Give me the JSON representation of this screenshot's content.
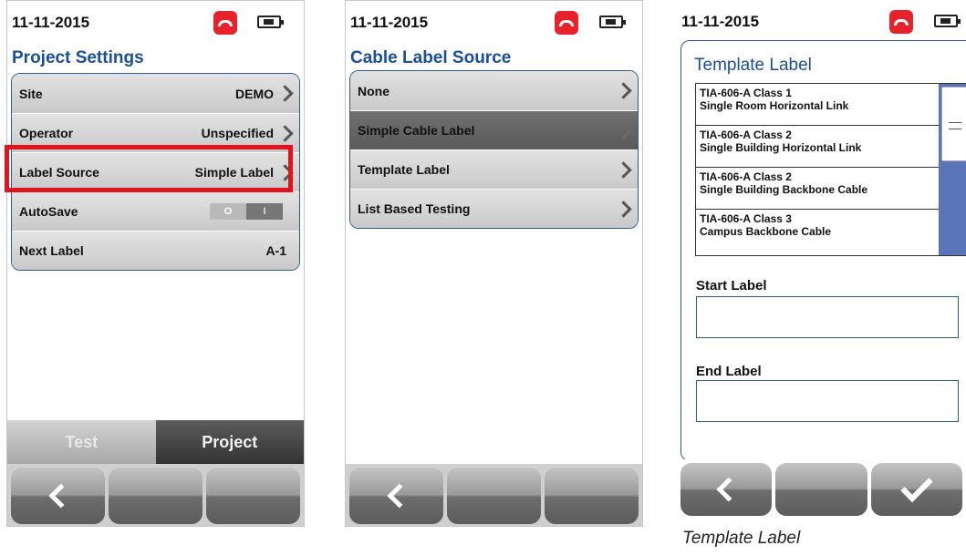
{
  "screens": [
    {
      "date": "11-11-2015",
      "title": "Project Settings",
      "rows": [
        {
          "label": "Site",
          "value": "DEMO"
        },
        {
          "label": "Operator",
          "value": "Unspecified"
        },
        {
          "label": "Label Source",
          "value": "Simple Label"
        },
        {
          "label": "AutoSave",
          "toggle_off": "O",
          "toggle_on": "I"
        },
        {
          "label": "Next Label",
          "value": "A-1"
        }
      ],
      "tabs": [
        "Test",
        "Project"
      ]
    },
    {
      "date": "11-11-2015",
      "title": "Cable Label Source",
      "rows": [
        {
          "label": "None"
        },
        {
          "label": "Simple Cable Label",
          "selected": true
        },
        {
          "label": "Template Label"
        },
        {
          "label": "List Based Testing"
        }
      ]
    },
    {
      "date": "11-11-2015",
      "title": "Template Label",
      "templates": [
        {
          "line1": "TIA-606-A Class 1",
          "line2": "Single Room Horizontal Link"
        },
        {
          "line1": "TIA-606-A Class 2",
          "line2": "Single Building Horizontal Link"
        },
        {
          "line1": "TIA-606-A Class 2",
          "line2": "Single Building Backbone Cable"
        },
        {
          "line1": "TIA-606-A Class 3",
          "line2": "Campus Backbone Cable"
        }
      ],
      "start_label": "Start Label",
      "end_label": "End Label"
    }
  ],
  "caption": "Template Label",
  "colors": {
    "title_blue": "#1a4f9c",
    "highlight_red": "#e3131b",
    "phone_red": "#e8222a"
  },
  "icons": [
    "phone-icon",
    "battery-icon",
    "chevron-right-icon",
    "back-arrow-icon",
    "checkmark-icon"
  ]
}
